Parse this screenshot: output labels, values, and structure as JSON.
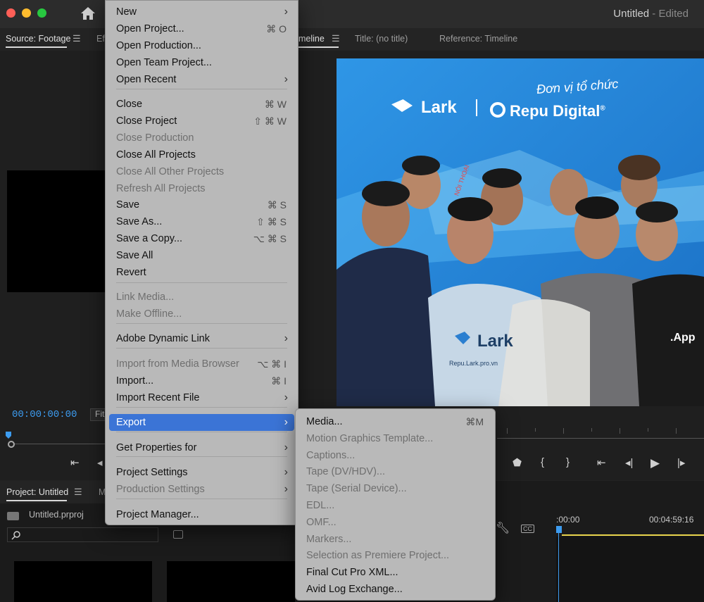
{
  "window": {
    "title": "Untitled",
    "status": "- Edited",
    "traffic_colors": [
      "#ff5f57",
      "#febc2e",
      "#28c840"
    ]
  },
  "panels": {
    "source_tab": "Source: Footage",
    "effects_tab_partial": "Ef",
    "timeline_tab_partial": "meline",
    "title_tab": "Title: (no title)",
    "reference_tab": "Reference: Timeline",
    "source_timecode": "00:00:00:00",
    "fit_label": "Fit",
    "project_tab": "Project: Untitled",
    "media_tab_partial": "M",
    "project_file": "Untitled.prproj",
    "timeline_start": ":00:00",
    "timeline_end": "00:04:59:16"
  },
  "video": {
    "banner_text": "Đơn vị tổ chức",
    "logo1": "Lark",
    "logo2": "Repu Digital",
    "logo2_mark": "®",
    "shirt_text": "Lark",
    "shirt_url": "Repu.Lark.pro.vn",
    "badge_text": ".App",
    "sign_text": "NÓI THOẠI"
  },
  "file_menu": {
    "items": [
      {
        "label": "New",
        "shortcut": "",
        "submenu": true,
        "enabled": true
      },
      {
        "label": "Open Project...",
        "shortcut": "⌘ O",
        "submenu": false,
        "enabled": true
      },
      {
        "label": "Open Production...",
        "shortcut": "",
        "submenu": false,
        "enabled": true
      },
      {
        "label": "Open Team Project...",
        "shortcut": "",
        "submenu": false,
        "enabled": true
      },
      {
        "label": "Open Recent",
        "shortcut": "",
        "submenu": true,
        "enabled": true
      },
      {
        "label": "Close",
        "shortcut": "⌘ W",
        "submenu": false,
        "enabled": true
      },
      {
        "label": "Close Project",
        "shortcut": "⇧ ⌘ W",
        "submenu": false,
        "enabled": true
      },
      {
        "label": "Close Production",
        "shortcut": "",
        "submenu": false,
        "enabled": false
      },
      {
        "label": "Close All Projects",
        "shortcut": "",
        "submenu": false,
        "enabled": true
      },
      {
        "label": "Close All Other Projects",
        "shortcut": "",
        "submenu": false,
        "enabled": false
      },
      {
        "label": "Refresh All Projects",
        "shortcut": "",
        "submenu": false,
        "enabled": false
      },
      {
        "label": "Save",
        "shortcut": "⌘ S",
        "submenu": false,
        "enabled": true
      },
      {
        "label": "Save As...",
        "shortcut": "⇧ ⌘ S",
        "submenu": false,
        "enabled": true
      },
      {
        "label": "Save a Copy...",
        "shortcut": "⌥ ⌘ S",
        "submenu": false,
        "enabled": true
      },
      {
        "label": "Save All",
        "shortcut": "",
        "submenu": false,
        "enabled": true
      },
      {
        "label": "Revert",
        "shortcut": "",
        "submenu": false,
        "enabled": true
      },
      {
        "label": "Link Media...",
        "shortcut": "",
        "submenu": false,
        "enabled": false
      },
      {
        "label": "Make Offline...",
        "shortcut": "",
        "submenu": false,
        "enabled": false
      },
      {
        "label": "Adobe Dynamic Link",
        "shortcut": "",
        "submenu": true,
        "enabled": true
      },
      {
        "label": "Import from Media Browser",
        "shortcut": "⌥ ⌘ I",
        "submenu": false,
        "enabled": false
      },
      {
        "label": "Import...",
        "shortcut": "⌘ I",
        "submenu": false,
        "enabled": true
      },
      {
        "label": "Import Recent File",
        "shortcut": "",
        "submenu": true,
        "enabled": true
      },
      {
        "label": "Export",
        "shortcut": "",
        "submenu": true,
        "enabled": true,
        "selected": true
      },
      {
        "label": "Get Properties for",
        "shortcut": "",
        "submenu": true,
        "enabled": true
      },
      {
        "label": "Project Settings",
        "shortcut": "",
        "submenu": true,
        "enabled": true
      },
      {
        "label": "Production Settings",
        "shortcut": "",
        "submenu": true,
        "enabled": false
      },
      {
        "label": "Project Manager...",
        "shortcut": "",
        "submenu": false,
        "enabled": true
      }
    ]
  },
  "export_menu": {
    "items": [
      {
        "label": "Media...",
        "shortcut": "⌘M",
        "enabled": true
      },
      {
        "label": "Motion Graphics Template...",
        "shortcut": "",
        "enabled": false
      },
      {
        "label": "Captions...",
        "shortcut": "",
        "enabled": false
      },
      {
        "label": "Tape (DV/HDV)...",
        "shortcut": "",
        "enabled": false
      },
      {
        "label": "Tape (Serial Device)...",
        "shortcut": "",
        "enabled": false
      },
      {
        "label": "EDL...",
        "shortcut": "",
        "enabled": false
      },
      {
        "label": "OMF...",
        "shortcut": "",
        "enabled": false
      },
      {
        "label": "Markers...",
        "shortcut": "",
        "enabled": false
      },
      {
        "label": "Selection as Premiere Project...",
        "shortcut": "",
        "enabled": false
      },
      {
        "label": "Final Cut Pro XML...",
        "shortcut": "",
        "enabled": true
      },
      {
        "label": "Avid Log Exchange...",
        "shortcut": "",
        "enabled": true
      }
    ]
  }
}
